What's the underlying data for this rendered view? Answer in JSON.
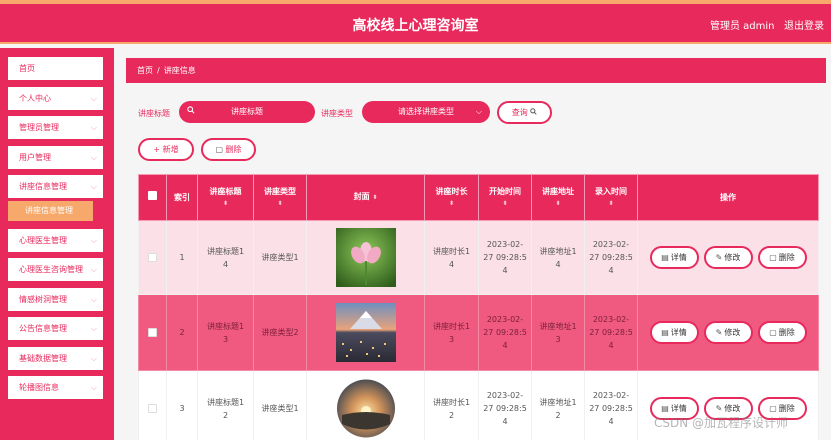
{
  "header": {
    "title": "高校线上心理咨询室",
    "user": "管理员 admin",
    "logout": "退出登录"
  },
  "sidebar": {
    "items": [
      {
        "label": "首页",
        "chevron": ""
      },
      {
        "label": "个人中心",
        "chevron": "⌵"
      },
      {
        "label": "管理员管理",
        "chevron": "⌵"
      },
      {
        "label": "用户管理",
        "chevron": "⌵"
      },
      {
        "label": "讲座信息管理",
        "chevron": "⌵"
      },
      {
        "label": "心理医生管理",
        "chevron": "⌵"
      },
      {
        "label": "心理医生咨询管理",
        "chevron": "⌵"
      },
      {
        "label": "情感树洞管理",
        "chevron": "⌵"
      },
      {
        "label": "公告信息管理",
        "chevron": "⌵"
      },
      {
        "label": "基础数据管理",
        "chevron": "⌵"
      },
      {
        "label": "轮播图信息",
        "chevron": "⌵"
      }
    ],
    "sub_active": "讲座信息管理"
  },
  "breadcrumb": {
    "home": "首页",
    "sep": "/",
    "current": "讲座信息"
  },
  "search": {
    "title_label": "讲座标题",
    "title_placeholder": "讲座标题",
    "type_label": "讲座类型",
    "type_placeholder": "请选择讲座类型",
    "query_button": "查询",
    "search_icon": "search-icon"
  },
  "actions": {
    "add": "新增",
    "delete": "删除",
    "add_icon": "+",
    "delete_icon": "🗑"
  },
  "table": {
    "headers": {
      "index": "索引",
      "title": "讲座标题",
      "type": "讲座类型",
      "cover": "封面",
      "duration": "讲座时长",
      "start": "开始时间",
      "address": "讲座地址",
      "entry": "录入时间",
      "ops": "操作"
    },
    "sort_icon": "⬍",
    "rows": [
      {
        "index": "1",
        "title": "讲座标题1\n4",
        "type": "讲座类型1",
        "cover": "lotus-flower",
        "duration": "讲座时长1\n4",
        "start": "2023-02-\n27 09:28:5\n4",
        "address": "讲座地址1\n4",
        "entry": "2023-02-\n27 09:28:5\n4"
      },
      {
        "index": "2",
        "title": "讲座标题1\n3",
        "type": "讲座类型2",
        "cover": "city-mountain",
        "duration": "讲座时长1\n3",
        "start": "2023-02-\n27 09:28:5\n4",
        "address": "讲座地址1\n3",
        "entry": "2023-02-\n27 09:28:5\n4"
      },
      {
        "index": "3",
        "title": "讲座标题1\n2",
        "type": "讲座类型1",
        "cover": "sunset-fisheye",
        "duration": "讲座时长1\n2",
        "start": "2023-02-\n27 09:28:5\n4",
        "address": "讲座地址1\n2",
        "entry": "2023-02-\n27 09:28:5\n4"
      }
    ],
    "row_ops": {
      "detail": "详情",
      "edit": "修改",
      "delete": "删除"
    }
  },
  "watermark": "CSDN @加瓦程序设计师",
  "colors": {
    "primary": "#e8295c",
    "accent": "#f7a86b",
    "row_alt": "#f05a80",
    "row_light": "#fbe0e7"
  }
}
